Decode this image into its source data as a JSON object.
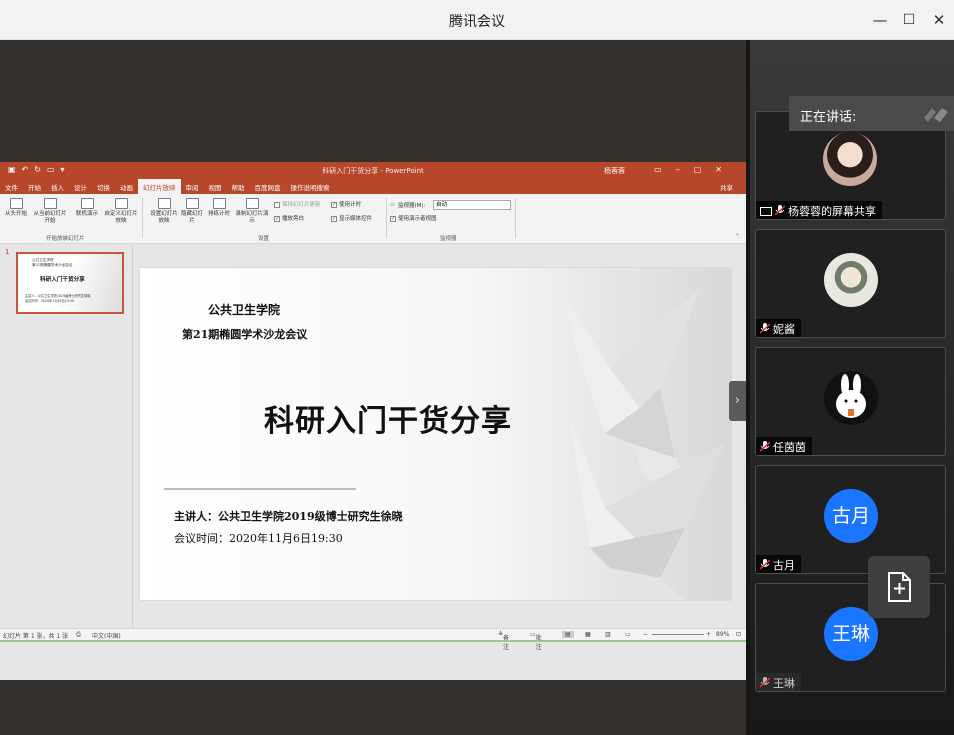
{
  "window": {
    "title": "腾讯会议",
    "controls": {
      "minimize": "—",
      "maximize": "☐",
      "close": "✕"
    }
  },
  "ppt": {
    "doc_title": "科研入门干货分享 - PowerPoint",
    "user": "杨蓉蓉",
    "tabs": [
      "文件",
      "开始",
      "插入",
      "设计",
      "切换",
      "动画",
      "幻灯片放映",
      "审阅",
      "视图",
      "帮助",
      "百度网盘",
      "操作说明搜索"
    ],
    "active_tab": "幻灯片放映",
    "share": "共享",
    "ribbon": {
      "from_start": "从头开始",
      "from_current": "从当前幻灯片开始",
      "online": "联机演示",
      "custom": "自定义幻灯片放映",
      "group_start": "开始放映幻灯片",
      "setup": "设置幻灯片放映",
      "hide": "隐藏幻灯片",
      "rehearse": "排练计时",
      "record": "录制幻灯片演示",
      "chk_narration": "播放旁白",
      "chk_timing": "使用计时",
      "chk_media": "显示媒体控件",
      "chk_hidden_pointer": "保持幻灯片更新",
      "group_setup": "设置",
      "monitor_label": "监视器(M):",
      "monitor_value": "自动",
      "chk_presenter": "使用演示者视图",
      "group_monitor": "监视器"
    },
    "slide_number": "1",
    "thumb": {
      "line1": "公共卫生学院",
      "line2": "第21期椭圆学术沙龙会议",
      "title": "科研入门干货分享",
      "speaker": "主讲人：公共卫生学院2019级博士研究生徐晓",
      "time": "会议时间：2020年11月6日19:30"
    },
    "slide": {
      "institution": "公共卫生学院",
      "subtitle": "第21期椭圆学术沙龙会议",
      "title": "科研入门干货分享",
      "speaker": "主讲人：公共卫生学院2019级博士研究生徐晓",
      "time": "会议时间：2020年11月6日19:30"
    },
    "status": {
      "slide_info": "幻灯片 第 1 张，共 1 张",
      "language": "中文(中国)",
      "notes": "备注",
      "comments": "批注",
      "zoom": "89%"
    }
  },
  "sidebar": {
    "speaking_label": "正在讲话:",
    "participants": [
      {
        "name": "杨蓉蓉的屏幕共享",
        "avatar": "photo-woman",
        "sharing": true
      },
      {
        "name": "妮酱",
        "avatar": "photo-illustration"
      },
      {
        "name": "任茵茵",
        "avatar": "rabbit-sticker"
      },
      {
        "name": "古月",
        "avatar_text": "古月",
        "avatar_color": "#1a75ff"
      },
      {
        "name": "王琳",
        "avatar_text": "王琳",
        "avatar_color": "#1a75ff"
      }
    ],
    "file_button": "add-file"
  },
  "colors": {
    "ppt_accent": "#b7472a",
    "meeting_blue": "#1a75ff",
    "mute_red": "#e0323c"
  }
}
